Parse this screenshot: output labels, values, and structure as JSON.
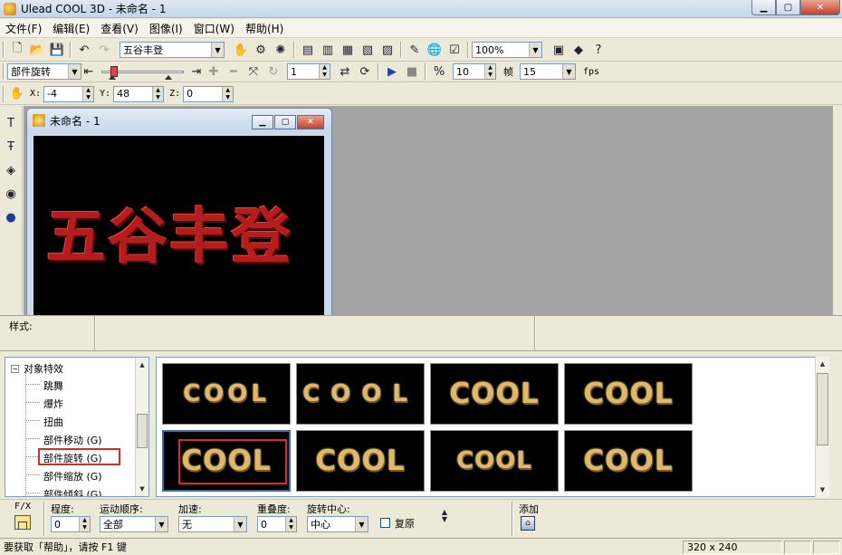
{
  "window": {
    "title": "Ulead COOL 3D - 未命名 - 1"
  },
  "menu": [
    "文件(F)",
    "编辑(E)",
    "查看(V)",
    "图像(I)",
    "窗口(W)",
    "帮助(H)"
  ],
  "toolbar1": {
    "text_combo": "五谷丰登",
    "zoom": "100%"
  },
  "toolbar2": {
    "mode": "部件旋转",
    "frame_value": "1",
    "rate_value": "10",
    "frame_label": "帧",
    "frame_count": "15",
    "fps_label": "fps"
  },
  "toolbar3": {
    "x_label": "X:",
    "x_value": "-4",
    "y_label": "Y:",
    "y_value": "48",
    "z_label": "Z:",
    "z_value": "0"
  },
  "document": {
    "title": "未命名 - 1",
    "canvas_text": "五谷丰登",
    "canvas_text_color": "#b51d1d"
  },
  "style_bar": {
    "label": "样式:"
  },
  "tree": {
    "root": "对象特效",
    "items": [
      "跳舞",
      "爆炸",
      "扭曲",
      "部件移动 (G)",
      "部件旋转 (G)",
      "部件缩放 (G)",
      "部件倾斜 (G)"
    ],
    "selected_index": 4
  },
  "gallery": {
    "thumbnails": [
      "COOL",
      "COOL",
      "COOL",
      "COOL",
      "COOL",
      "COOL",
      "COOL",
      "COOL"
    ],
    "selected_index": 4,
    "text_color": "#e0b86a"
  },
  "params": {
    "fx_label": "F/X",
    "degree_label": "程度:",
    "degree_value": "0",
    "order_label": "运动顺序:",
    "order_value": "全部",
    "accel_label": "加速:",
    "accel_value": "无",
    "overlap_label": "重叠度:",
    "overlap_value": "0",
    "center_label": "旋转中心:",
    "center_value": "中心",
    "restore_label": "复原",
    "add_label": "添加"
  },
  "status": {
    "hint": "要获取「帮助」，请按 F1 键",
    "size": "320 x 240"
  }
}
